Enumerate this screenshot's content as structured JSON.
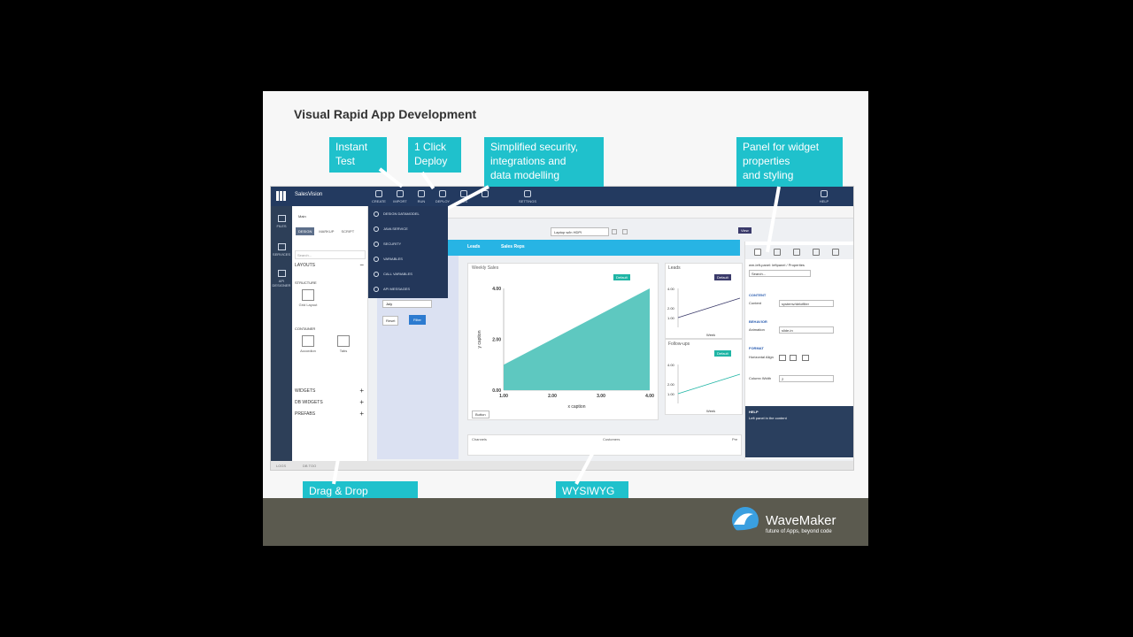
{
  "slide": {
    "title": "Visual Rapid App Development"
  },
  "callouts": {
    "instant_test": "Instant\nTest",
    "deploy": "1 Click\nDeploy",
    "security": "Simplified security,\nintegrations and\ndata modelling",
    "panel": "Panel for widget\nproperties\nand styling",
    "dragdrop": "Drag & Drop\nWidgets, Layouts,\n& themes",
    "wysiwyg": "WYSIWYG\ncanvas"
  },
  "brand": {
    "name": "WaveMaker",
    "tagline": "future of Apps, beyond code",
    "accent": "#1fc1cc"
  },
  "ide": {
    "project": "SalesVision",
    "toolbar": [
      "CREATE",
      "IMPORT",
      "RUN",
      "DEPLOY",
      "VCS",
      "",
      "SETTINGS",
      "HELP"
    ],
    "leftnav": [
      "FILES",
      "SERVICES",
      "API DESIGNER"
    ],
    "page_tab": "Main",
    "view_tabs": [
      "DESIGN",
      "MARKUP",
      "SCRIPT"
    ],
    "search_placeholder": "Search...",
    "sections": {
      "layouts": "LAYOUTS",
      "structure": "STRUCTURE",
      "container": "CONTAINER",
      "widgets": "WIDGETS",
      "db_widgets": "DB WIDGETS",
      "prefabs": "PREFABS"
    },
    "widget_items": {
      "grid": "Grid Layout",
      "accordion": "Accordion",
      "tabs": "Tabs"
    },
    "dropdown": [
      "DESIGN DATAMODEL",
      "JAVA SERVICE",
      "SECURITY",
      "VARIABLES",
      "CALL VARIABLES",
      "API MESSAGES"
    ],
    "device": "Laptop w/in HDPI",
    "view_btn": "View",
    "app_nav": [
      "Leads",
      "Sales Reps"
    ],
    "filter": {
      "month": "July",
      "reset": "Reset",
      "filter": "Filter"
    },
    "chart": {
      "title": "Weekly Sales",
      "badge": "Default",
      "xlabel": "x caption",
      "ylabel": "y caption",
      "button": "Button"
    },
    "side_charts": [
      {
        "title": "Leads",
        "badge": "Default",
        "x": "Week"
      },
      {
        "title": "Follow-ups",
        "badge": "Default",
        "x": "Week"
      }
    ],
    "bottom": {
      "channels": "Channels",
      "customers": "Customers",
      "pre": "Pre"
    },
    "statusbar": {
      "logs": "LOGS",
      "db": "DB TOO"
    },
    "props": {
      "path": "wm-left-panel: leftpanel / Properties",
      "search": "Search...",
      "content_head": "CONTENT",
      "content_label": "Content",
      "content_value": "systemv/delofilter",
      "behavior_head": "BEHAVIOR",
      "animation_label": "Animation",
      "animation_value": "slide-in",
      "format_head": "FORMAT",
      "halign_label": "Horizontal Align",
      "col_label": "Column Width",
      "col_value": "2",
      "help_head": "HELP",
      "help_text": "Left panel in the content"
    }
  },
  "chart_data": [
    {
      "type": "area",
      "title": "Weekly Sales",
      "x": [
        1,
        4
      ],
      "y": [
        1,
        4
      ],
      "xlabel": "x caption",
      "ylabel": "y caption",
      "xticks": [
        "1.00",
        "2.00",
        "3.00",
        "4.00"
      ],
      "yticks": [
        "0.00",
        "2.00",
        "4.00"
      ],
      "xlim": [
        1,
        4
      ],
      "ylim": [
        0,
        4
      ],
      "color": "#5ec8c0"
    },
    {
      "type": "line",
      "title": "Leads",
      "x": [
        1,
        4
      ],
      "y": [
        1,
        3
      ],
      "yticks": [
        "1.00",
        "2.00",
        "4.00"
      ],
      "xlabel": "Week"
    },
    {
      "type": "line",
      "title": "Follow-ups",
      "x": [
        1,
        4
      ],
      "y": [
        1,
        3
      ],
      "yticks": [
        "1.00",
        "2.00",
        "4.00"
      ],
      "xlabel": "Week"
    }
  ]
}
